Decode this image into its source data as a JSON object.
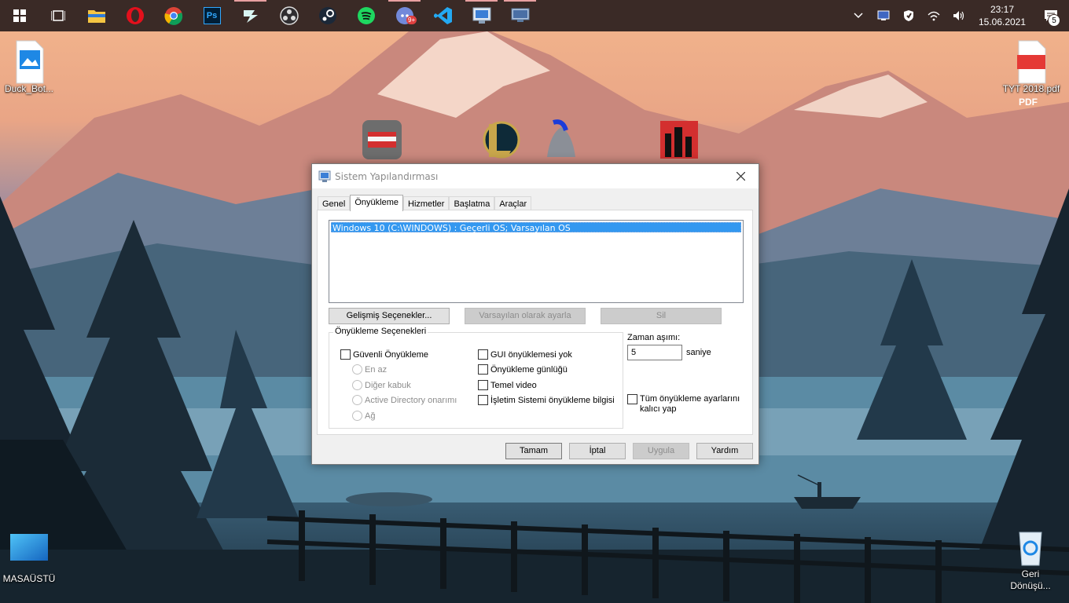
{
  "taskbar": {
    "apps": [
      {
        "name": "start-button",
        "icon": "windows-logo-icon"
      },
      {
        "name": "task-view-button",
        "icon": "task-view-icon"
      },
      {
        "name": "file-explorer",
        "icon": "folder-icon"
      },
      {
        "name": "opera",
        "icon": "opera-icon"
      },
      {
        "name": "chrome",
        "icon": "chrome-icon"
      },
      {
        "name": "photoshop",
        "icon": "photoshop-icon",
        "label": "Ps"
      },
      {
        "name": "filmora",
        "icon": "filmora-icon"
      },
      {
        "name": "obs",
        "icon": "obs-icon"
      },
      {
        "name": "steam",
        "icon": "steam-icon"
      },
      {
        "name": "spotify",
        "icon": "spotify-icon"
      },
      {
        "name": "discord",
        "icon": "discord-icon",
        "badge": "9+"
      },
      {
        "name": "vscode",
        "icon": "vscode-icon"
      },
      {
        "name": "system-config",
        "icon": "system-config-icon"
      },
      {
        "name": "remote-desktop",
        "icon": "monitor-icon"
      }
    ],
    "clock": {
      "time": "23:17",
      "date": "15.06.2021"
    },
    "notifications_count": "5"
  },
  "desktop": {
    "icons": [
      {
        "label": "Duck_Bot..."
      },
      {
        "label": "TYT 2018.pdf"
      },
      {
        "label": "MASAÜSTÜ"
      },
      {
        "label": "Geri Dönüşü..."
      }
    ],
    "pdf_badge": "PDF"
  },
  "dialog": {
    "title": "Sistem Yapılandırması",
    "tabs": [
      "Genel",
      "Önyükleme",
      "Hizmetler",
      "Başlatma",
      "Araçlar"
    ],
    "selected_tab": "Önyükleme",
    "os_entry": "Windows 10 (C:\\WINDOWS) : Geçerli OS; Varsayılan OS",
    "buttons": {
      "advanced": "Gelişmiş Seçenekler...",
      "set_default": "Varsayılan olarak ayarla",
      "delete": "Sil",
      "ok": "Tamam",
      "cancel": "İptal",
      "apply": "Uygula",
      "help": "Yardım"
    },
    "boot_options": {
      "legend": "Önyükleme Seçenekleri",
      "safe_boot": "Güvenli Önyükleme",
      "minimal": "En az",
      "alternate_shell": "Diğer kabuk",
      "ad_repair": "Active Directory onarımı",
      "network": "Ağ",
      "no_gui": "GUI önyüklemesi yok",
      "boot_log": "Önyükleme günlüğü",
      "base_video": "Temel video",
      "os_info": "İşletim Sistemi önyükleme bilgisi"
    },
    "timeout": {
      "label": "Zaman aşımı:",
      "value": "5",
      "unit": "saniye"
    },
    "make_permanent": "Tüm önyükleme ayarlarını kalıcı yap"
  }
}
